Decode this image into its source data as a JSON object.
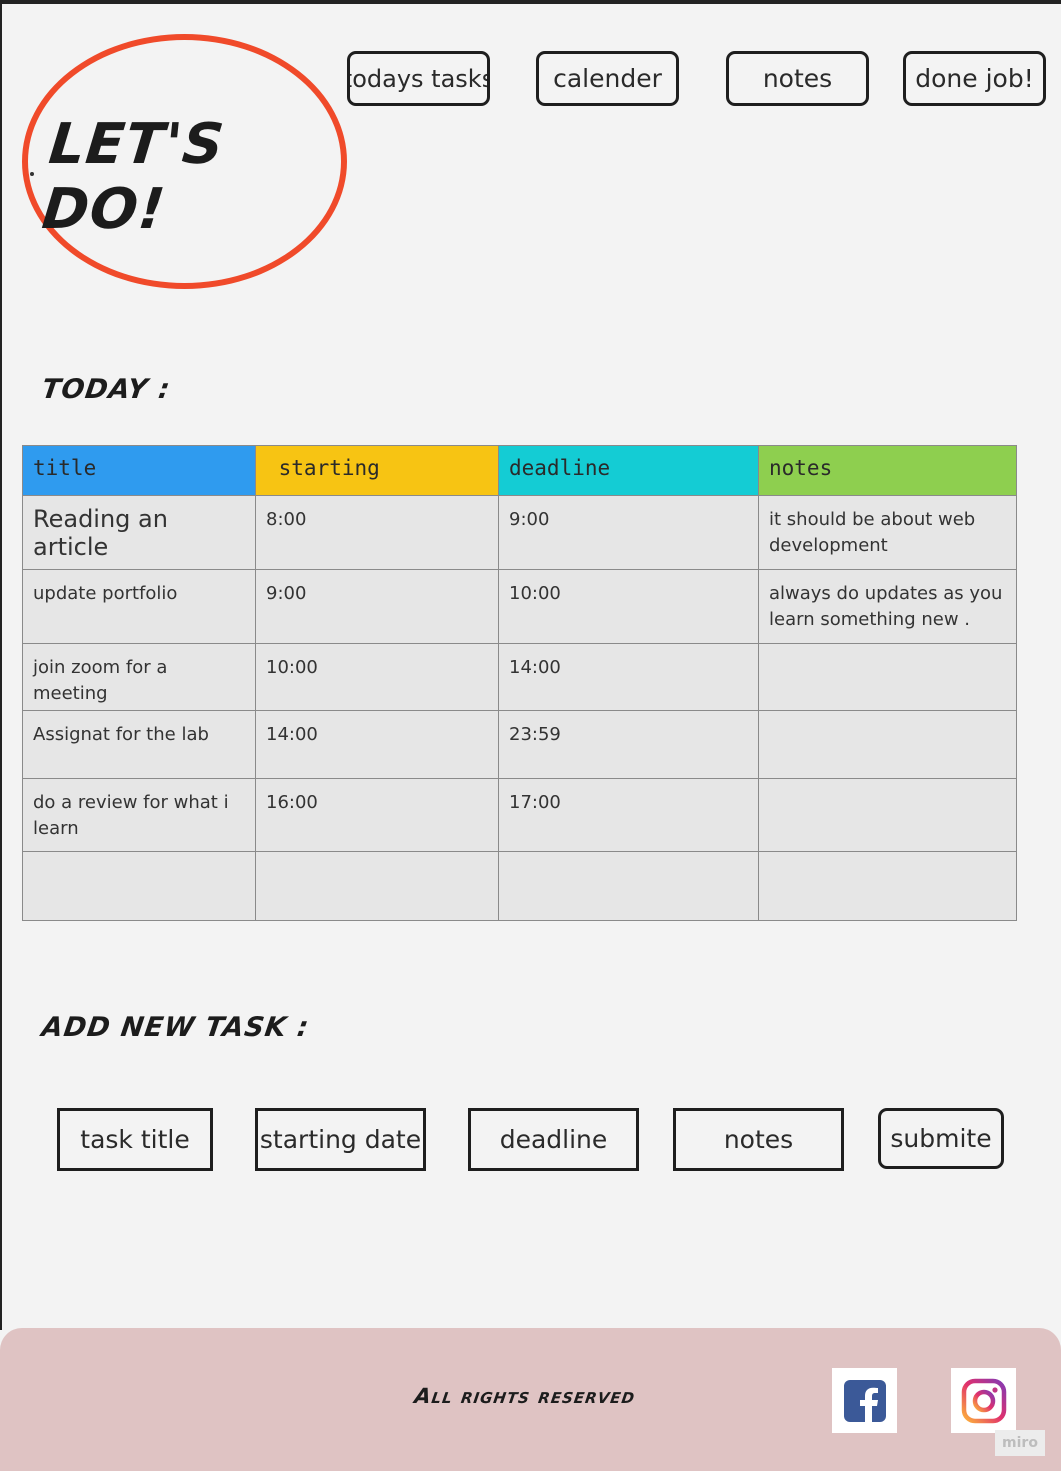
{
  "logo": {
    "text": "LET'S DO!"
  },
  "nav": {
    "items": [
      {
        "label": "todays tasks"
      },
      {
        "label": "calender"
      },
      {
        "label": "notes"
      },
      {
        "label": "done job!"
      }
    ]
  },
  "today": {
    "heading": "TODAY :",
    "columns": [
      {
        "label": "title",
        "color": "#2f9bef"
      },
      {
        "label": " starting",
        "color": "#f7c413"
      },
      {
        "label": "deadline",
        "color": "#14ccd4"
      },
      {
        "label": "notes",
        "color": "#8ecf4f"
      }
    ],
    "rows": [
      {
        "title": "Reading an article",
        "starting": "8:00",
        "deadline": "9:00",
        "notes": "it should be about web development"
      },
      {
        "title": "update portfolio",
        "starting": "9:00",
        "deadline": "10:00",
        "notes": "always do updates as you learn something new ."
      },
      {
        "title": "join zoom for a meeting",
        "starting": "10:00",
        "deadline": "14:00",
        "notes": ""
      },
      {
        "title": "Assignat for the lab",
        "starting": "14:00",
        "deadline": "23:59",
        "notes": ""
      },
      {
        "title": "do a review for what i learn",
        "starting": "16:00",
        "deadline": "17:00",
        "notes": ""
      },
      {
        "title": "",
        "starting": "",
        "deadline": "",
        "notes": ""
      }
    ]
  },
  "add_task": {
    "heading": "ADD NEW TASK :",
    "fields": [
      {
        "label": "task title"
      },
      {
        "label": "starting date"
      },
      {
        "label": "deadline"
      },
      {
        "label": "notes"
      }
    ],
    "submit_label": "submite"
  },
  "footer": {
    "text": "All rights reserved",
    "icons": [
      "facebook-icon",
      "instagram-icon"
    ],
    "watermark": "miro"
  },
  "colors": {
    "accent_logo": "#f04a2a",
    "footer_bg": "#dfc3c3",
    "facebook": "#3b5998"
  }
}
